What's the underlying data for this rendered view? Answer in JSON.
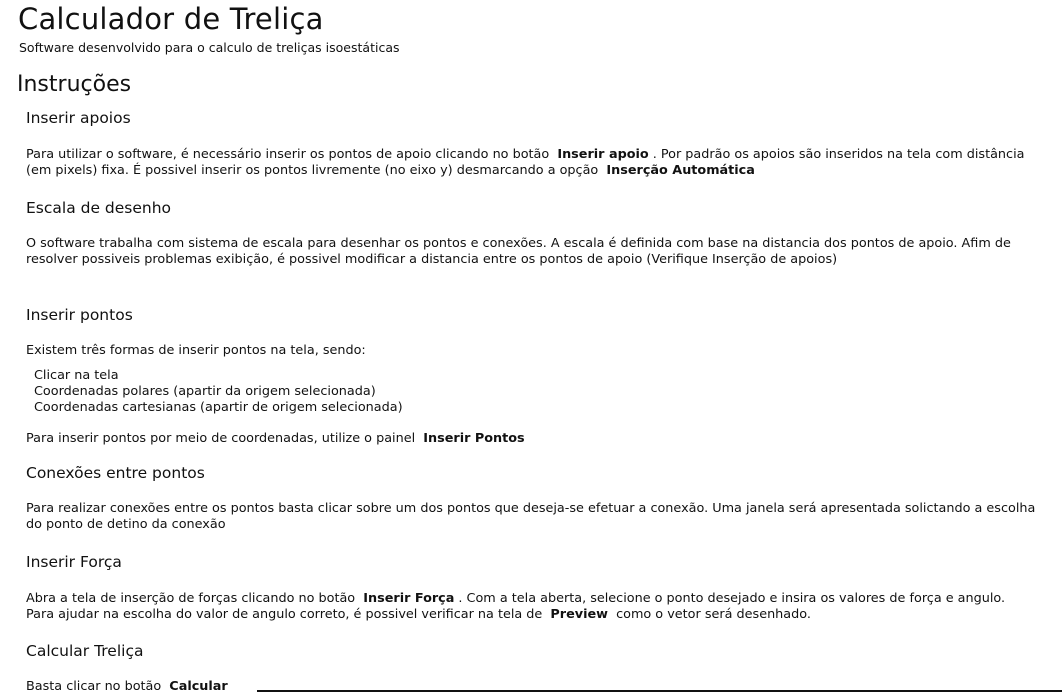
{
  "header": {
    "title": "Calculador de Treliça",
    "subtitle": "Software desenvolvido para o calculo de treliças isoestáticas"
  },
  "instructions": {
    "title": "Instruções",
    "apoios": {
      "title": "Inserir apoios",
      "p1": "Para utilizar o software, é necessário inserir os pontos de apoio clicando no botão",
      "b1": "Inserir apoio",
      "p2": ". Por padrão os apoios são inseridos na tela com distância (em pixels) fixa. É possivel inserir os pontos livremente (no eixo y) desmarcando a opção",
      "b2": "Inserção Automática"
    },
    "escala": {
      "title": "Escala de desenho",
      "p": "O software trabalha com sistema de escala para desenhar os pontos e conexões. A escala é definida com base na distancia dos pontos de apoio. Afim de resolver possiveis problemas exibição, é possivel modificar a distancia entre os pontos de apoio (Verifique Inserção de apoios)"
    },
    "pontos": {
      "title": "Inserir pontos",
      "intro": "Existem três formas de inserir pontos na tela, sendo:",
      "items": [
        "Clicar na tela",
        "Coordenadas polares (apartir da origem selecionada)",
        "Coordenadas cartesianas (apartir de origem selecionada)"
      ],
      "p1": "Para inserir pontos por meio de coordenadas, utilize o painel",
      "b1": "Inserir Pontos"
    },
    "conexoes": {
      "title": "Conexões entre pontos",
      "p": "Para realizar conexões entre os pontos basta clicar sobre um dos pontos que deseja-se efetuar a conexão. Uma janela será apresentada solictando a escolha do ponto de detino da conexão"
    },
    "forca": {
      "title": "Inserir Força",
      "p1": "Abra a tela de inserção de forças clicando no botão",
      "b1": "Inserir Força",
      "p2": ". Com a tela aberta, selecione o ponto desejado e insira os valores de força e angulo. Para ajudar na escolha do valor de angulo correto, é possivel verificar na tela de",
      "b2": "Preview",
      "p3": "como o vetor será desenhado."
    },
    "calcular": {
      "title": "Calcular Treliça",
      "p1": "Basta clicar no botão",
      "b1": "Calcular"
    }
  }
}
